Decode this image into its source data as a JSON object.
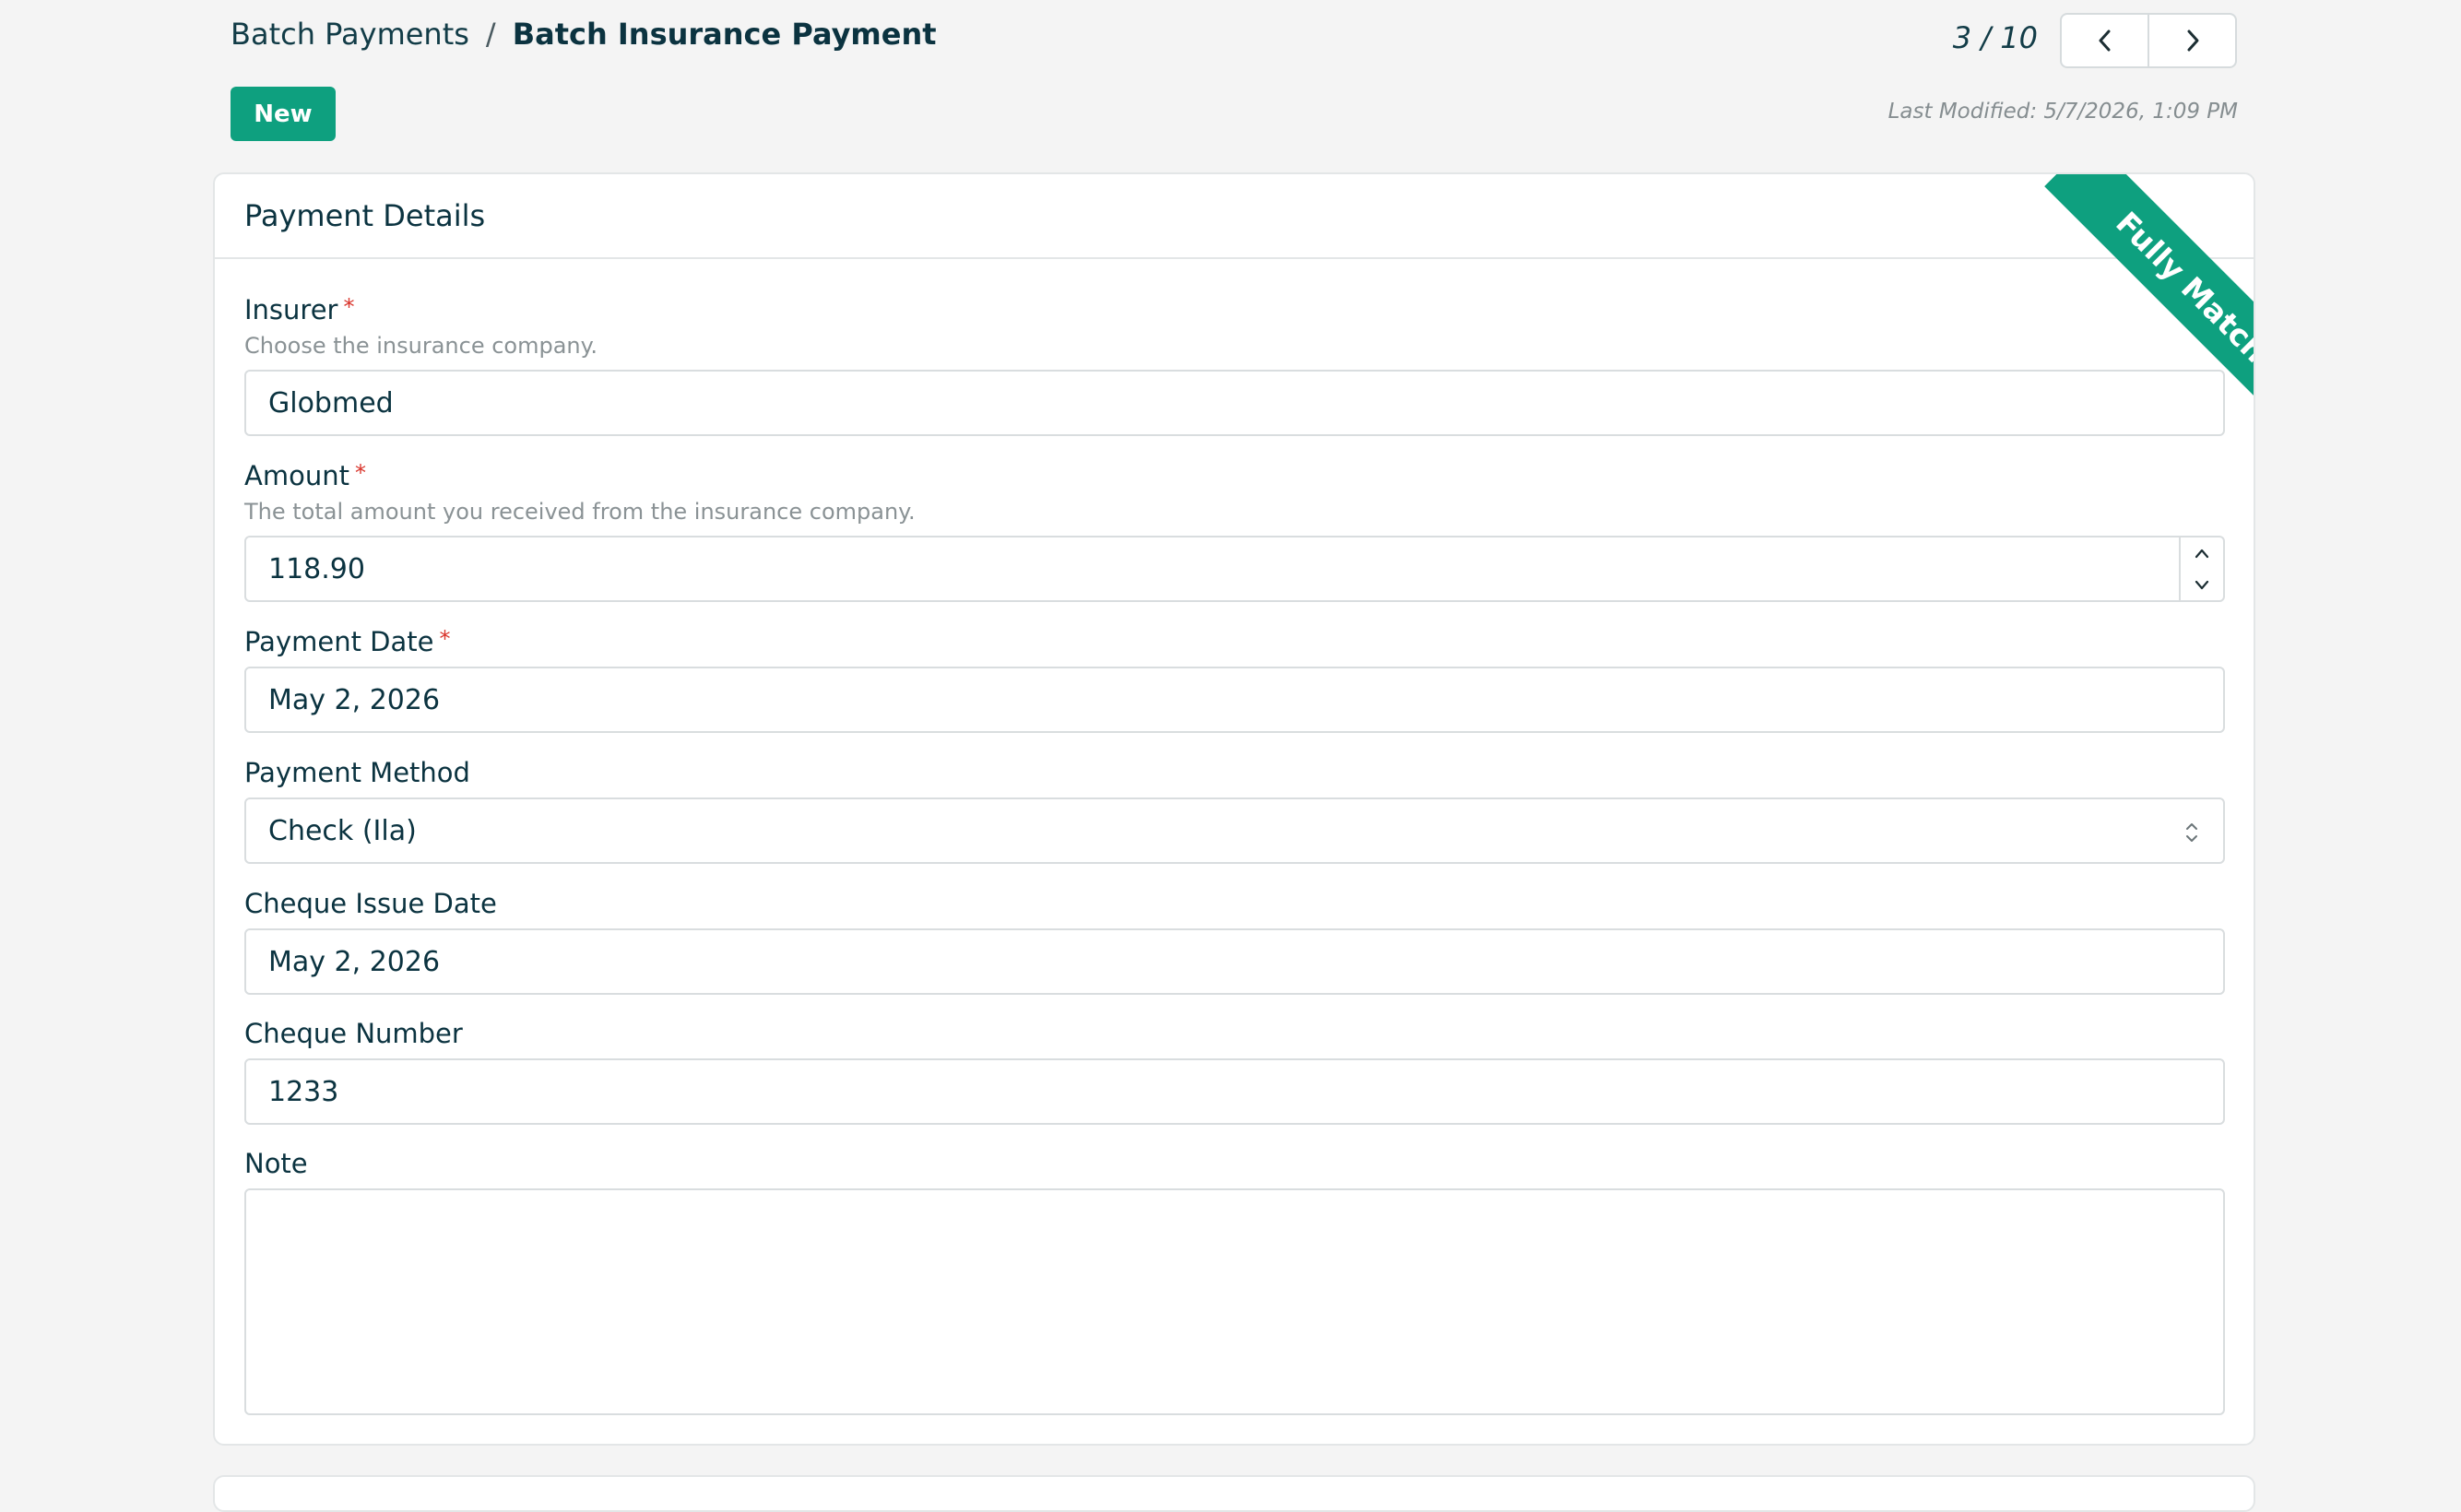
{
  "breadcrumb": {
    "parent": "Batch Payments",
    "separator": "/",
    "current": "Batch Insurance Payment"
  },
  "toolbar": {
    "new_label": "New"
  },
  "pager": {
    "counter": "3 / 10",
    "prev_icon": "chevron-left-icon",
    "next_icon": "chevron-right-icon"
  },
  "last_modified": "Last Modified: 5/7/2026, 1:09 PM",
  "card": {
    "title": "Payment Details",
    "ribbon": "Fully Match"
  },
  "form": {
    "insurer": {
      "label": "Insurer",
      "required": "*",
      "help": "Choose the insurance company.",
      "value": "Globmed"
    },
    "amount": {
      "label": "Amount",
      "required": "*",
      "help": "The total amount you received from the insurance company.",
      "value": "118.90"
    },
    "payment_date": {
      "label": "Payment Date",
      "required": "*",
      "value": "May 2, 2026"
    },
    "payment_method": {
      "label": "Payment Method",
      "value": "Check (Ila)"
    },
    "cheque_issue_date": {
      "label": "Cheque Issue Date",
      "value": "May 2, 2026"
    },
    "cheque_number": {
      "label": "Cheque Number",
      "value": "1233"
    },
    "note": {
      "label": "Note",
      "value": ""
    }
  },
  "colors": {
    "accent": "#0ea07f",
    "text": "#0b3340",
    "required": "#d9342b",
    "muted": "#8a9295"
  }
}
